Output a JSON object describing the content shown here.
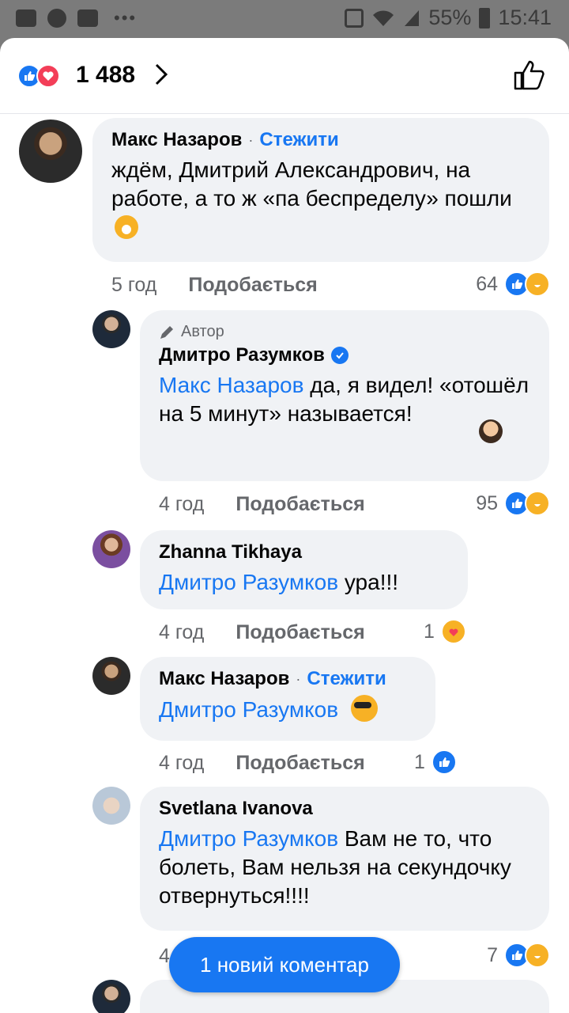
{
  "status_bar": {
    "battery": "55%",
    "time": "15:41"
  },
  "reactions_header": {
    "count": "1 488"
  },
  "comments": [
    {
      "author": "Макс Назаров",
      "follow": "Стежити",
      "text": "ждём, Дмитрий Александрович, на работе, а то ж «па беспределу» пошли",
      "time": "5 год",
      "like": "Подобається",
      "reactions": "64"
    },
    {
      "badge": "Автор",
      "author": "Дмитро Разумков",
      "mention": "Макс Назаров",
      "text": " да, я видел! «отошёл на 5 минут» называется!",
      "time": "4 год",
      "like": "Подобається",
      "reactions": "95"
    },
    {
      "author": "Zhanna  Tikhaya",
      "mention": "Дмитро Разумков",
      "text": " ура!!!",
      "time": "4 год",
      "like": "Подобається",
      "reactions": "1"
    },
    {
      "author": "Макс Назаров",
      "follow": "Стежити",
      "mention": "Дмитро Разумков",
      "time": "4 год",
      "like": "Подобається",
      "reactions": "1"
    },
    {
      "author": "Svetlana  Ivanova",
      "mention": "Дмитро Разумков",
      "text": " Вам не то, что болеть, Вам нельзя на секундочку отвернуться!!!!",
      "time": "4",
      "reactions": "7"
    }
  ],
  "new_comment_button": "1 новий коментар",
  "colors": {
    "accent": "#1877f2",
    "bubble": "#f0f2f5",
    "love": "#f33e58",
    "haha": "#f7b125"
  }
}
